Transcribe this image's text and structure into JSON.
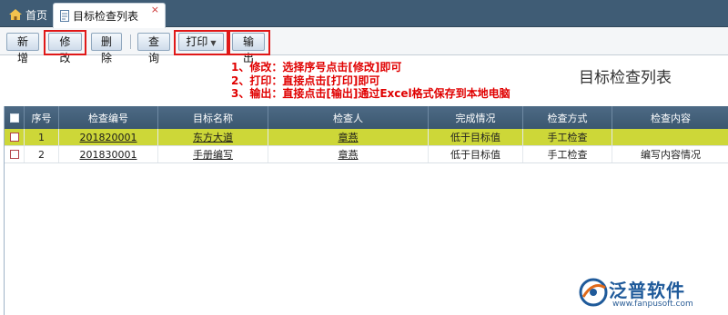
{
  "tabs": {
    "home_label": "首页",
    "active_label": "目标检查列表",
    "close_glyph": "×"
  },
  "toolbar": {
    "add": "新增",
    "edit": "修改",
    "delete": "删除",
    "query": "查询",
    "print": "打印",
    "export": "输出"
  },
  "instructions": [
    "1、修改：选择序号点击[修改]即可",
    "2、打印：直接点击[打印]即可",
    "3、输出：直接点击[输出]通过Excel格式保存到本地电脑"
  ],
  "page_title": "目标检查列表",
  "table": {
    "headers": [
      "序号",
      "检查编号",
      "目标名称",
      "检查人",
      "完成情况",
      "检查方式",
      "检查内容"
    ],
    "rows": [
      [
        "1",
        "201820001",
        "东方大道",
        "章燕",
        "低于目标值",
        "手工检查",
        ""
      ],
      [
        "2",
        "201830001",
        "手册编写",
        "章燕",
        "低于目标值",
        "手工检查",
        "编写内容情况"
      ]
    ],
    "selected_row": 0
  },
  "logo": {
    "brand": "泛普软件",
    "url": "www.fanpusoft.com"
  },
  "colors": {
    "tabbar": "#3f5c75",
    "header": "#44617b",
    "selected_row": "#cdd738",
    "highlight": "#e01818",
    "note_text": "#e00000"
  },
  "icons": {
    "home": "house-icon",
    "tab": "document-icon",
    "close": "close-icon",
    "dropdown": "caret-down-icon"
  }
}
